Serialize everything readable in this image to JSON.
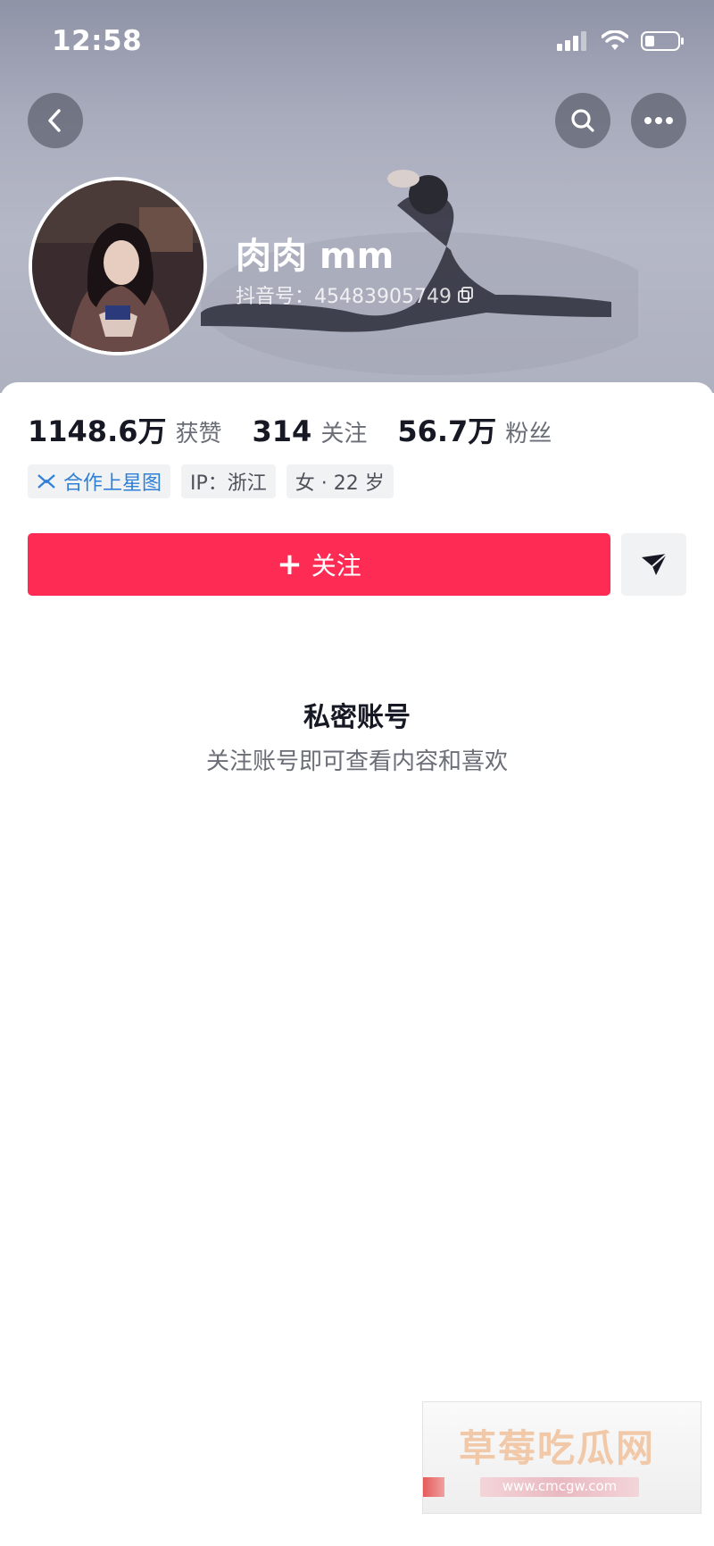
{
  "status_bar": {
    "time": "12:58"
  },
  "header": {
    "name": "肉肉 mm",
    "douyin_id": "抖音号：45483905749"
  },
  "stats": [
    {
      "value": "1148.6万",
      "label": "获赞"
    },
    {
      "value": "314",
      "label": "关注"
    },
    {
      "value": "56.7万",
      "label": "粉丝"
    }
  ],
  "tags": {
    "cooperation": "合作上星图",
    "ip": "IP：浙江",
    "gender_age": "女 · 22 岁"
  },
  "actions": {
    "follow_plus": "+",
    "follow_label": "关注"
  },
  "private": {
    "title": "私密账号",
    "subtitle": "关注账号即可查看内容和喜欢"
  },
  "watermark": {
    "text": "草莓吃瓜网",
    "url": "www.cmcgw.com"
  },
  "colors": {
    "follow_button": "#fe2c55",
    "tag_blue": "#2f7fd6",
    "tag_bg": "#f1f2f4"
  },
  "icons": [
    "back-icon",
    "search-icon",
    "more-icon",
    "copy-icon",
    "xingtu-icon",
    "share-icon",
    "signal-icon",
    "wifi-icon",
    "battery-icon"
  ]
}
